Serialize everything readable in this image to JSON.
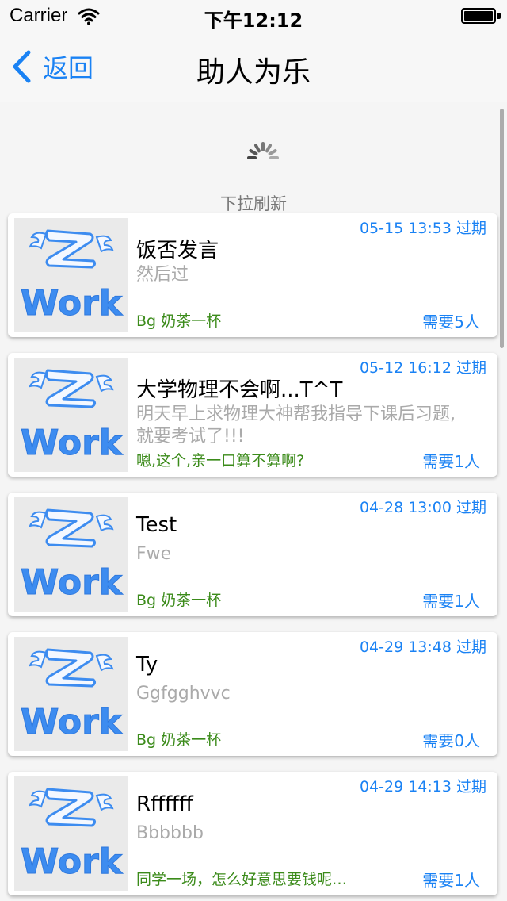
{
  "status_bar": {
    "carrier": "Carrier",
    "time": "下午12:12"
  },
  "nav": {
    "back_label": "返回",
    "title": "助人为乐"
  },
  "refresh": {
    "text": "下拉刷新"
  },
  "logo_text": "Work",
  "cards": [
    {
      "title": "饭否发言",
      "desc": "然后过",
      "date": "05-15 13:53 过期",
      "reward": "Bg 奶茶一杯",
      "need": "需要5人"
    },
    {
      "title": "大学物理不会啊...T^T",
      "desc": "明天早上求物理大神帮我指导下课后习题,就要考试了!!!",
      "date": "05-12 16:12 过期",
      "reward": "嗯,这个,亲一口算不算啊?",
      "need": "需要1人"
    },
    {
      "title": "Test",
      "desc": "Fwe",
      "date": "04-28 13:00 过期",
      "reward": "Bg 奶茶一杯",
      "need": "需要1人"
    },
    {
      "title": "Ty",
      "desc": "Ggfgghvvc",
      "date": "04-29 13:48 过期",
      "reward": "Bg 奶茶一杯",
      "need": "需要0人"
    },
    {
      "title": "Rffffff",
      "desc": "Bbbbbb",
      "date": "04-29 14:13 过期",
      "reward": "同学一场，怎么好意思要钱呢…",
      "need": "需要1人"
    }
  ],
  "colors": {
    "accent": "#1a82f4",
    "reward_green": "#3b8b1a",
    "desc_gray": "#aaaaaa"
  }
}
